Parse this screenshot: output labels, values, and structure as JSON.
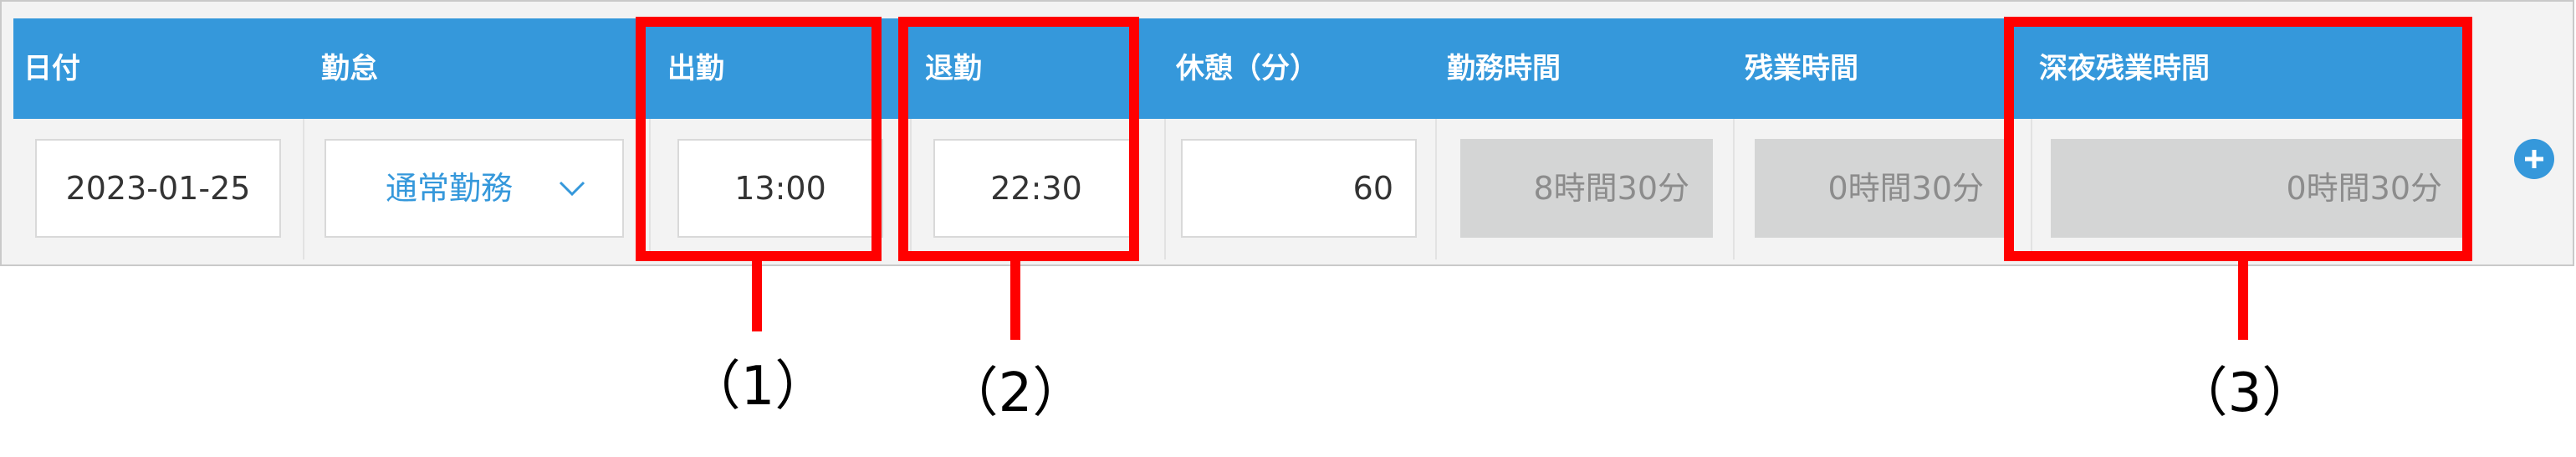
{
  "columns": {
    "date": "日付",
    "attendance": "勤怠",
    "clock_in": "出勤",
    "clock_out": "退勤",
    "break_min": "休憩（分）",
    "work_time": "勤務時間",
    "overtime": "残業時間",
    "night_overtime": "深夜残業時間"
  },
  "row": {
    "date": "2023-01-25",
    "attendance_type": "通常勤務",
    "clock_in": "13:00",
    "clock_out": "22:30",
    "break_min": "60",
    "work_time": "8時間30分",
    "overtime": "0時間30分",
    "night_overtime": "0時間30分"
  },
  "callouts": [
    "（1）",
    "（2）",
    "（3）"
  ],
  "colors": {
    "header_bg": "#3598db",
    "accent": "#3598db",
    "highlight": "#ff0000",
    "readonly_bg": "#d4d5d5"
  },
  "icons": {
    "dropdown": "chevron-down-icon",
    "add_row": "plus-circle-icon"
  }
}
